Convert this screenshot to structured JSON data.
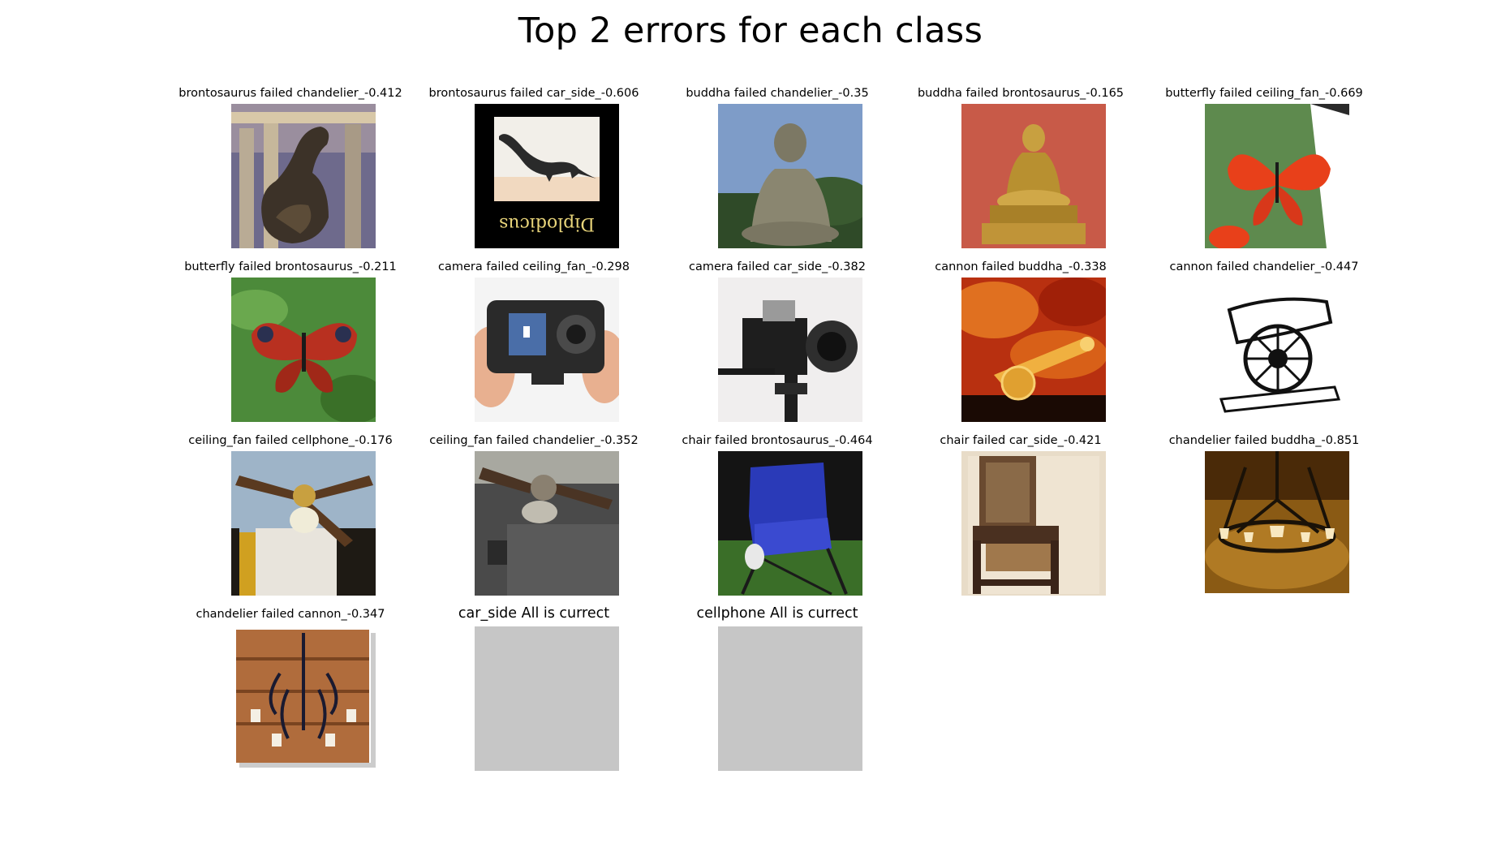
{
  "figure": {
    "title": "Top 2 errors for each class"
  },
  "cells": [
    {
      "caption": "brontosaurus failed chandelier_-0.412",
      "image": "brontosaurus-statue-photo"
    },
    {
      "caption": "brontosaurus failed car_side_-0.606",
      "image": "diplodocus-drawing-photo",
      "image_text": "Diplodicus"
    },
    {
      "caption": "buddha failed chandelier_-0.35",
      "image": "buddha-statue-photo"
    },
    {
      "caption": "buddha failed brontosaurus_-0.165",
      "image": "golden-buddha-photo"
    },
    {
      "caption": "butterfly failed ceiling_fan_-0.669",
      "image": "orange-butterfly-photo"
    },
    {
      "caption": "butterfly failed brontosaurus_-0.211",
      "image": "peacock-butterfly-photo"
    },
    {
      "caption": "camera failed ceiling_fan_-0.298",
      "image": "compact-camera-photo"
    },
    {
      "caption": "camera failed car_side_-0.382",
      "image": "slr-camera-photo"
    },
    {
      "caption": "cannon failed buddha_-0.338",
      "image": "glass-cannon-photo"
    },
    {
      "caption": "cannon failed chandelier_-0.447",
      "image": "cannon-sketch"
    },
    {
      "caption": "ceiling_fan failed cellphone_-0.176",
      "image": "ceiling-fan-photo"
    },
    {
      "caption": "ceiling_fan failed chandelier_-0.352",
      "image": "dark-ceiling-fan-photo"
    },
    {
      "caption": "chair failed brontosaurus_-0.464",
      "image": "blue-folding-chair-photo"
    },
    {
      "caption": "chair failed car_side_-0.421",
      "image": "wooden-chair-photo"
    },
    {
      "caption": "chandelier failed buddha_-0.851",
      "image": "wrought-chandelier-photo"
    },
    {
      "caption": "chandelier failed cannon_-0.347",
      "image": "wall-chandelier-photo"
    },
    {
      "caption": "car_side All is currect",
      "image": "blank-placeholder"
    },
    {
      "caption": "cellphone All is currect",
      "image": "blank-placeholder"
    }
  ],
  "colors": {
    "background": "#ffffff",
    "placeholder": "#c6c6c6",
    "text": "#000000"
  }
}
